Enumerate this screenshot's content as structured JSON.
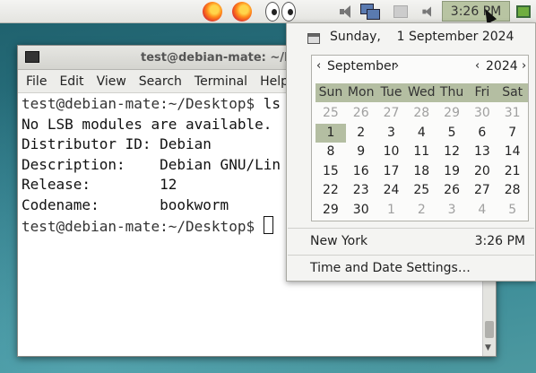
{
  "panel": {
    "clock": "3:26 PM",
    "colors": {
      "clock_bg": "#b8c4a2",
      "desktop": "#2c7684"
    },
    "icons": [
      "firefox-icon",
      "firefox-icon",
      "xeyes-icon",
      "volume-icon",
      "network-icon",
      "volume-icon",
      "monitor-icon"
    ]
  },
  "terminal": {
    "title": "test@debian-mate: ~/D",
    "menu": [
      "File",
      "Edit",
      "View",
      "Search",
      "Terminal",
      "Help"
    ],
    "prompt_user": "test@debian-mate",
    "prompt_path": ":~/Desktop$",
    "command": " ls",
    "output": [
      "No LSB modules are available.",
      "Distributor ID: Debian",
      "Description:    Debian GNU/Lin",
      "Release:        12",
      "Codename:       bookworm"
    ]
  },
  "calendar": {
    "date_heading": "Sunday,    1 September 2024",
    "month": "September",
    "year": "2024",
    "weekdays": [
      "Sun",
      "Mon",
      "Tue",
      "Wed",
      "Thu",
      "Fri",
      "Sat"
    ],
    "weeks": [
      [
        "25",
        "26",
        "27",
        "28",
        "29",
        "30",
        "31"
      ],
      [
        "1",
        "2",
        "3",
        "4",
        "5",
        "6",
        "7"
      ],
      [
        "8",
        "9",
        "10",
        "11",
        "12",
        "13",
        "14"
      ],
      [
        "15",
        "16",
        "17",
        "18",
        "19",
        "20",
        "21"
      ],
      [
        "22",
        "23",
        "24",
        "25",
        "26",
        "27",
        "28"
      ],
      [
        "29",
        "30",
        "1",
        "2",
        "3",
        "4",
        "5"
      ]
    ],
    "location": "New York",
    "location_time": "3:26 PM",
    "settings_label": "Time and Date Settings…"
  }
}
